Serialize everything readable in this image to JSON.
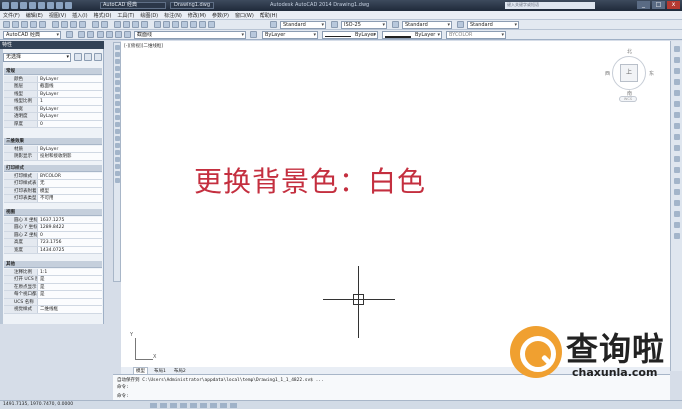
{
  "titlebar": {
    "workspace": "AutoCAD 经典",
    "tab": "Drawing1.dwg",
    "caption": "Autodesk AutoCAD 2014   Drawing1.dwg",
    "search_placeholder": "键入关键字或短语",
    "min": "_",
    "max": "□",
    "close": "x"
  },
  "menu": [
    "文件(F)",
    "编辑(E)",
    "视图(V)",
    "插入(I)",
    "格式(O)",
    "工具(T)",
    "绘图(D)",
    "标注(N)",
    "修改(M)",
    "参数(P)",
    "窗口(W)",
    "帮助(H)"
  ],
  "toolbar1": {
    "text_style": "Standard",
    "dim_style": "ISO-25",
    "table_style": "Standard",
    "mleader_style": "Standard"
  },
  "toolbar2": {
    "workspace": "AutoCAD 经典",
    "layer": "截面线",
    "color": "ByLayer",
    "linetype": "ByLayer",
    "lineweight": "ByLayer",
    "plotstyle": "BYCOLOR"
  },
  "palette": {
    "title": "特性",
    "selection": "无选择",
    "sections": {
      "general": "常规",
      "view3d": "三维效果",
      "plot": "打印样式",
      "view": "视图",
      "misc": "其他"
    },
    "general_rows": [
      {
        "k": "颜色",
        "v": "ByLayer"
      },
      {
        "k": "图层",
        "v": "截面线"
      },
      {
        "k": "线型",
        "v": "ByLayer"
      },
      {
        "k": "线型比例",
        "v": "1"
      },
      {
        "k": "线宽",
        "v": "ByLayer"
      },
      {
        "k": "透明度",
        "v": "ByLayer"
      },
      {
        "k": "厚度",
        "v": "0"
      }
    ],
    "view3d_rows": [
      {
        "k": "材质",
        "v": "ByLayer"
      },
      {
        "k": "阴影显示",
        "v": "投射和接收阴影"
      }
    ],
    "plot_rows": [
      {
        "k": "打印样式",
        "v": "BYCOLOR"
      },
      {
        "k": "打印样式表",
        "v": "无"
      },
      {
        "k": "打印表附着到",
        "v": "模型"
      },
      {
        "k": "打印表类型",
        "v": "不可用"
      }
    ],
    "view_rows": [
      {
        "k": "圆心 X 坐标",
        "v": "1637.1275"
      },
      {
        "k": "圆心 Y 坐标",
        "v": "1289.8422"
      },
      {
        "k": "圆心 Z 坐标",
        "v": "0"
      },
      {
        "k": "高度",
        "v": "723.1756"
      },
      {
        "k": "宽度",
        "v": "1434.0725"
      }
    ],
    "misc_rows": [
      {
        "k": "注释比例",
        "v": "1:1"
      },
      {
        "k": "打开 UCS 图标",
        "v": "是"
      },
      {
        "k": "在原点显示 U...",
        "v": "是"
      },
      {
        "k": "每个视口都显...",
        "v": "是"
      },
      {
        "k": "UCS 名称",
        "v": ""
      },
      {
        "k": "视觉样式",
        "v": "二维线框"
      }
    ]
  },
  "viewport_label": "[-][俯视][二维线框]",
  "viewcube": {
    "top": "上",
    "north": "北",
    "south": "南",
    "east": "东",
    "west": "西",
    "wcs": "WCS"
  },
  "overlay_text": "更换背景色：白色",
  "ucs": {
    "x": "X",
    "y": "Y"
  },
  "layout_tabs": [
    "模型",
    "布局1",
    "布局2"
  ],
  "command": {
    "line1": "自动保存到 C:\\Users\\Administrator\\appdata\\local\\temp\\Drawing1_1_1_4822.sv$ ...",
    "line2": "命令:",
    "prompt": "命令:"
  },
  "status": {
    "coords": "1491.7135, 1970.7470, 0.0000"
  },
  "watermark": {
    "brand": "查询啦",
    "url": "chaxunla.com"
  }
}
